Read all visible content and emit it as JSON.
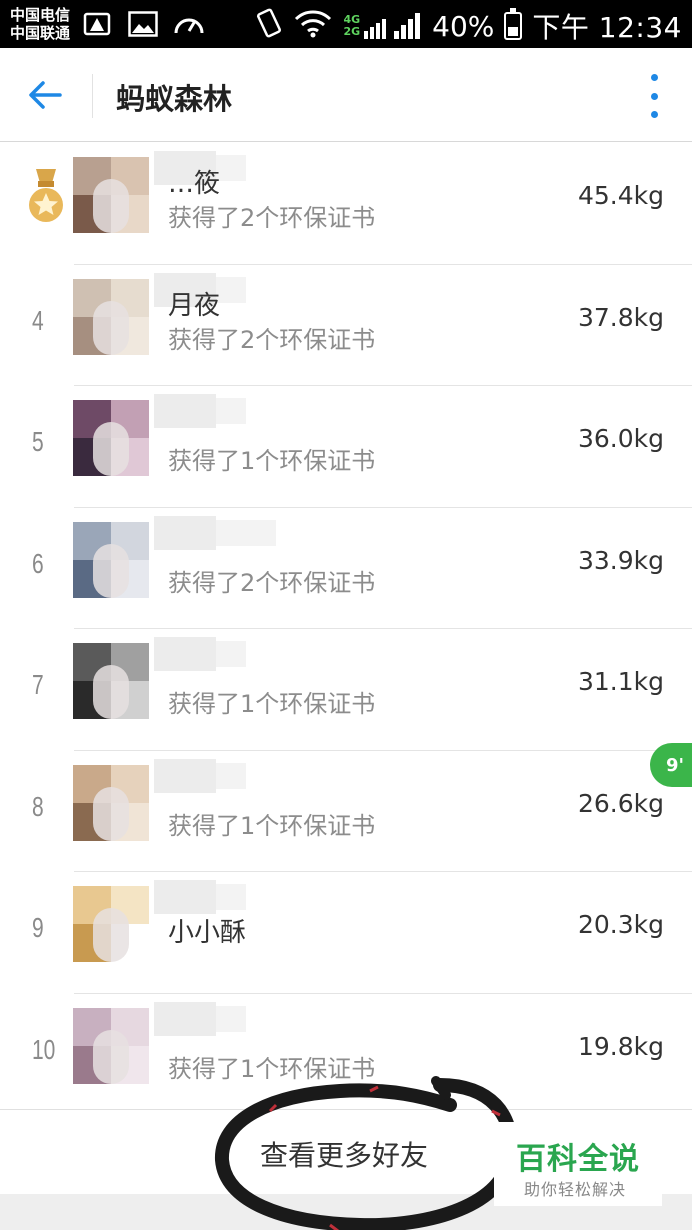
{
  "status_bar": {
    "carrier_1": "中国电信",
    "carrier_2": "中国联通",
    "network_1": "4G",
    "network_2": "2G",
    "battery": "40%",
    "battery_level": 0.4,
    "time": "下午 12:34",
    "icons": [
      "warning-icon",
      "image-icon",
      "speedometer-icon",
      "vibrate-icon",
      "wifi-icon",
      "signal-icon"
    ]
  },
  "toolbar": {
    "title": "蚂蚁森林",
    "back_icon": "arrow-left-icon",
    "more_icon": "more-vertical-icon"
  },
  "rows": [
    {
      "rank": "",
      "medal": true,
      "name": "…筱",
      "subtitle": "获得了2个环保证书",
      "weight": "45.4kg"
    },
    {
      "rank": "4",
      "medal": false,
      "name": "月夜",
      "subtitle": "获得了2个环保证书",
      "weight": "37.8kg"
    },
    {
      "rank": "5",
      "medal": false,
      "name": "",
      "subtitle": "获得了1个环保证书",
      "weight": "36.0kg"
    },
    {
      "rank": "6",
      "medal": false,
      "name": "",
      "subtitle": "获得了2个环保证书",
      "weight": "33.9kg"
    },
    {
      "rank": "7",
      "medal": false,
      "name": "",
      "subtitle": "获得了1个环保证书",
      "weight": "31.1kg"
    },
    {
      "rank": "8",
      "medal": false,
      "name": "",
      "subtitle": "获得了1个环保证书",
      "weight": "26.6kg"
    },
    {
      "rank": "9",
      "medal": false,
      "name": "小小酥",
      "subtitle": "",
      "weight": "20.3kg"
    },
    {
      "rank": "10",
      "medal": false,
      "name": "",
      "subtitle": "获得了1个环保证书",
      "weight": "19.8kg"
    }
  ],
  "float_badge": "9'",
  "footer": {
    "more_friends": "查看更多好友"
  },
  "watermark": {
    "main": "百科全说",
    "sub": "助你轻松解决"
  },
  "colors": {
    "accent": "#1e88e5",
    "watermark_green": "#2aa64f",
    "badge_green": "#3bb54a"
  }
}
